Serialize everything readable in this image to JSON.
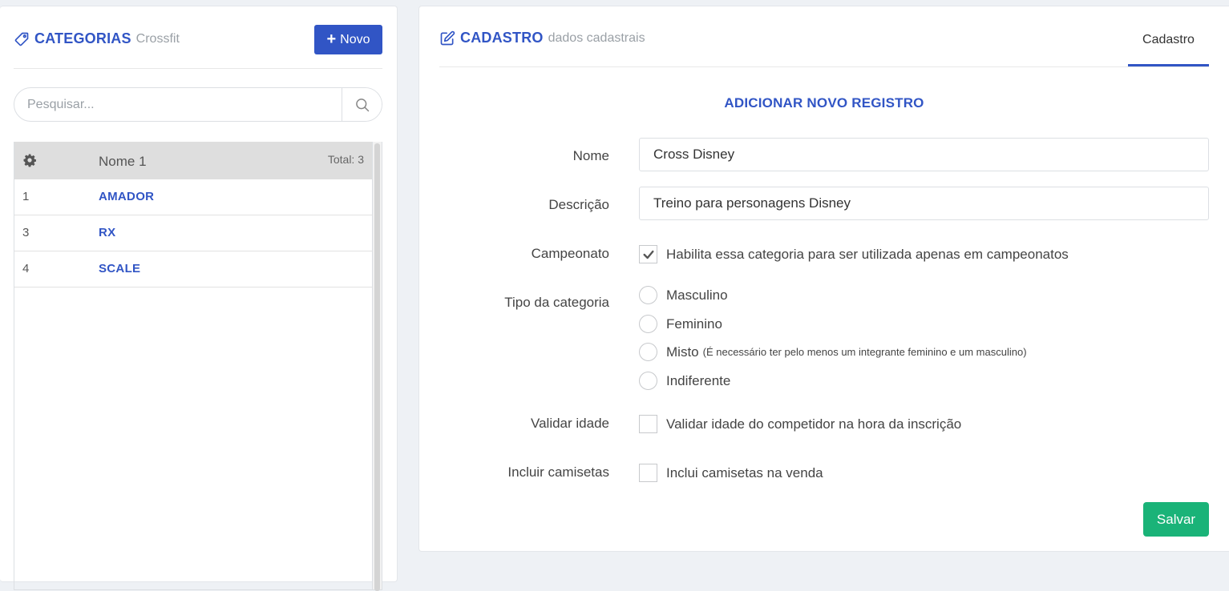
{
  "sidebar": {
    "title": "CATEGORIAS",
    "subtitle": "Crossfit",
    "new_button": "Novo",
    "search_placeholder": "Pesquisar...",
    "list_header": {
      "name_col": "Nome 1",
      "total": "Total: 3"
    },
    "rows": [
      {
        "id": "1",
        "name": "AMADOR"
      },
      {
        "id": "3",
        "name": "RX"
      },
      {
        "id": "4",
        "name": "SCALE"
      }
    ]
  },
  "main": {
    "title": "CADASTRO",
    "subtitle": "dados cadastrais",
    "tab": "Cadastro",
    "form_title": "ADICIONAR NOVO REGISTRO",
    "fields": {
      "nome": {
        "label": "Nome",
        "value": "Cross Disney"
      },
      "descricao": {
        "label": "Descrição",
        "value": "Treino para personagens Disney"
      },
      "campeonato": {
        "label": "Campeonato",
        "text": "Habilita essa categoria para ser utilizada apenas em campeonatos",
        "checked": true
      },
      "tipo": {
        "label": "Tipo da categoria",
        "options": [
          {
            "label": "Masculino",
            "note": ""
          },
          {
            "label": "Feminino",
            "note": ""
          },
          {
            "label": "Misto",
            "note": "(É necessário ter pelo menos um integrante feminino e um masculino)"
          },
          {
            "label": "Indiferente",
            "note": ""
          }
        ]
      },
      "validar_idade": {
        "label": "Validar idade",
        "text": "Validar idade do competidor na hora da inscrição",
        "checked": false
      },
      "camisetas": {
        "label": "Incluir camisetas",
        "text": "Inclui camisetas na venda",
        "checked": false
      }
    },
    "save_button": "Salvar"
  },
  "colors": {
    "primary": "#3155c5",
    "success": "#1ab378",
    "background": "#eef1f5"
  }
}
